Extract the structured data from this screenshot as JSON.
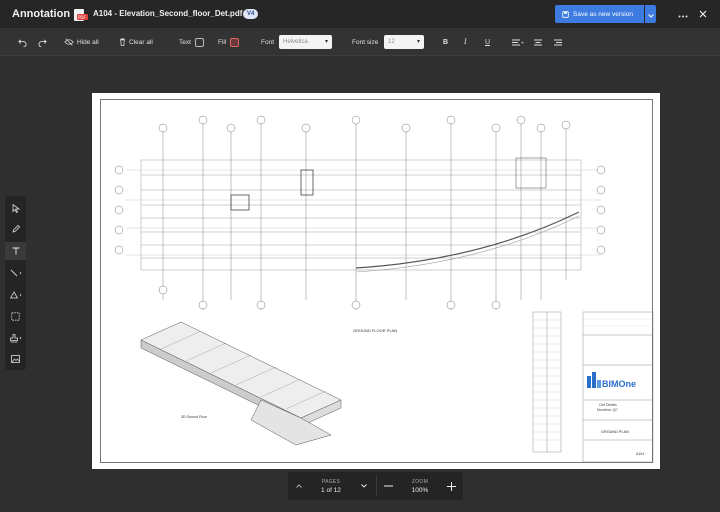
{
  "app": {
    "title": "Annotation"
  },
  "file": {
    "name": "A104 - Elevation_Second_floor_Det.pdf",
    "version": "V4"
  },
  "actions": {
    "save_label": "Save as new version"
  },
  "toolbar": {
    "hide_all": "Hide all",
    "clear_all": "Clear all",
    "text_label": "Text",
    "fill_label": "Fill",
    "font_label": "Font",
    "font_value": "Helvetica",
    "font_size_label": "Font size",
    "font_size_value": "12"
  },
  "drawing": {
    "plan_title": "GROUND FLOOR PLAN",
    "iso_caption": "3D Ground Floor",
    "logo_text": "BIMOne",
    "client_line1": "Cell Details",
    "client_line2": "Montréal, QC",
    "sheet_title": "GROUND PLAN",
    "sheet_number": "A104"
  },
  "pager": {
    "pages_caption": "PAGES",
    "pages_value": "1 of 12",
    "zoom_caption": "ZOOM",
    "zoom_value": "100%"
  },
  "colors": {
    "accent": "#3d7be0",
    "background": "#2f2f2f",
    "titlebar": "#262626",
    "fill_swatch": "#dd6666"
  }
}
